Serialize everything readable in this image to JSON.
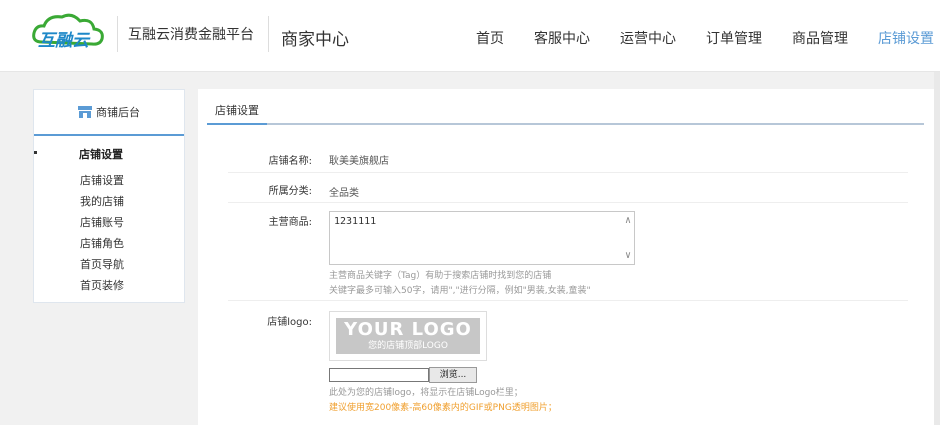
{
  "header": {
    "logo_text": "互融云",
    "brand": "互融云消费金融平台",
    "center_title": "商家中心",
    "nav": [
      "首页",
      "客服中心",
      "运营中心",
      "订单管理",
      "商品管理",
      "店铺设置"
    ],
    "active_nav": "店铺设置"
  },
  "sidebar": {
    "title": "商铺后台",
    "group": "店铺设置",
    "items": [
      "店铺设置",
      "我的店铺",
      "店铺账号",
      "店铺角色",
      "首页导航",
      "首页装修"
    ]
  },
  "main": {
    "tab": "店铺设置",
    "form": {
      "shop_name_label": "店铺名称:",
      "shop_name_value": "耿美美旗舰店",
      "category_label": "所属分类:",
      "category_value": "全品类",
      "main_goods_label": "主营商品:",
      "main_goods_value": "1231111",
      "hint1": "主营商品关键字（Tag）有助于搜索店铺时找到您的店铺",
      "hint2": "关键字最多可输入50字，请用\",\"进行分隔，例如\"男装,女装,童装\"",
      "logo_label": "店铺logo:",
      "logo_placeholder_big": "YOUR LOGO",
      "logo_placeholder_small": "您的店铺顶部LOGO",
      "browse_button": "浏览...",
      "logo_hint1": "此处为您的店铺logo，将显示在店铺Logo栏里；",
      "logo_hint2": "建议使用宽200像素-高60像素内的GIF或PNG透明图片；"
    }
  },
  "colors": {
    "accent": "#5b9bd5",
    "hint_orange": "#f0a030",
    "logo_green": "#3aa935",
    "logo_blue": "#1e88c8"
  },
  "icons": {
    "shop": "shop-icon",
    "scroll_up": "chevron-up-icon",
    "scroll_down": "chevron-down-icon"
  }
}
